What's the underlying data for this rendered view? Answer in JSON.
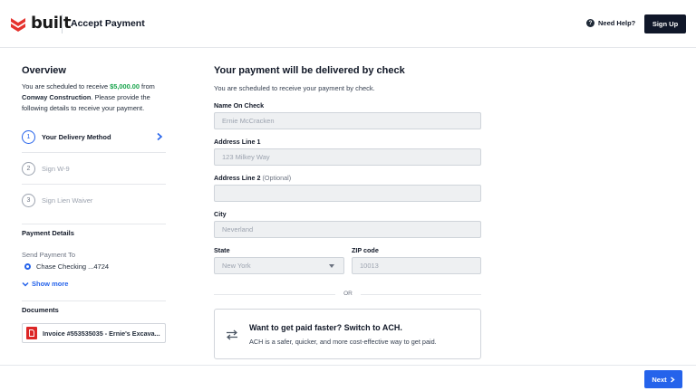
{
  "header": {
    "logo_text": "built",
    "title": "Accept Payment",
    "help_label": "Need Help?",
    "signup_label": "Sign Up"
  },
  "overview": {
    "title": "Overview",
    "text_1": "You are scheduled to receive ",
    "amount": "$5,000.00",
    "text_2": " from ",
    "payer": "Conway Construction",
    "text_3": ". Please provide the following details to receive your payment."
  },
  "steps": [
    {
      "number": "1",
      "label": "Your Delivery Method",
      "active": true
    },
    {
      "number": "2",
      "label": "Sign W-9",
      "active": false
    },
    {
      "number": "3",
      "label": "Sign Lien Waiver",
      "active": false
    }
  ],
  "payment_details": {
    "title": "Payment Details",
    "send_to_label": "Send Payment To",
    "account": "Chase Checking ...4724",
    "show_more": "Show more"
  },
  "documents": {
    "title": "Documents",
    "items": [
      {
        "label": "Invoice #553535035 - Ernie's Excava..."
      }
    ]
  },
  "main": {
    "title": "Your payment will be delivered by check",
    "subtitle": "You are scheduled to receive your payment by check.",
    "fields": {
      "name_label": "Name On Check",
      "name_value": "Ernie McCracken",
      "addr1_label": "Address Line 1",
      "addr1_value": "123 Milkey Way",
      "addr2_label": "Address Line 2",
      "addr2_optional": "(Optional)",
      "addr2_value": "",
      "city_label": "City",
      "city_value": "Neverland",
      "state_label": "State",
      "state_value": "New York",
      "zip_label": "ZIP code",
      "zip_value": "10013"
    },
    "or_text": "OR",
    "ach": {
      "title": "Want to get paid faster? Switch to ACH.",
      "text": "ACH is a safer, quicker, and more cost-effective way to get paid."
    }
  },
  "footer": {
    "next_label": "Next"
  },
  "colors": {
    "accent": "#2563eb",
    "dark": "#101729",
    "logo_red": "#e5322d",
    "amount_green": "#16a34a"
  }
}
